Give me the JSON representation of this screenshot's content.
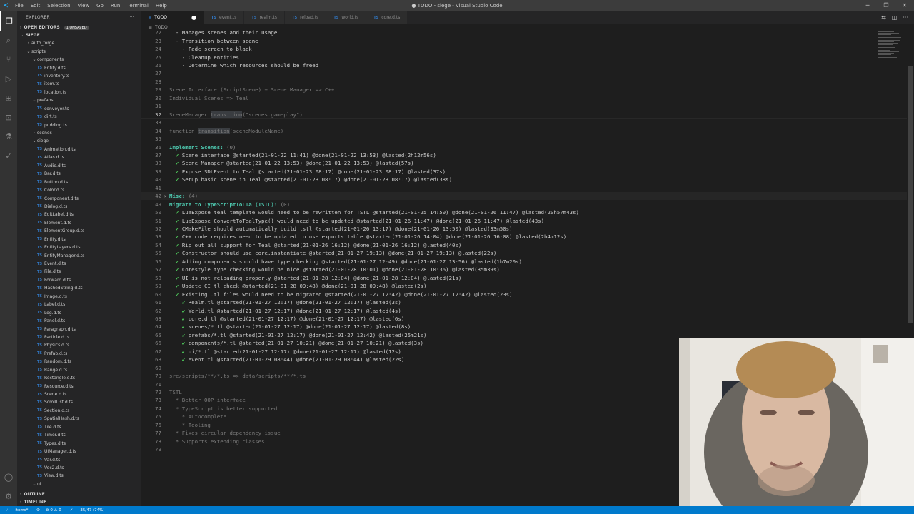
{
  "titlebar": {
    "menu": [
      "File",
      "Edit",
      "Selection",
      "View",
      "Go",
      "Run",
      "Terminal",
      "Help"
    ],
    "title": "● TODO - siege - Visual Studio Code"
  },
  "sidebar": {
    "header": "EXPLORER",
    "open_editors": "OPEN EDITORS",
    "unsaved_badge": "1 UNSAVED",
    "root": "SIEGE",
    "tree": [
      {
        "label": "auto_forge",
        "kind": "folder",
        "depth": 1,
        "open": false
      },
      {
        "label": "scripts",
        "kind": "folder",
        "depth": 1,
        "open": true
      },
      {
        "label": "components",
        "kind": "folder",
        "depth": 2,
        "open": true
      },
      {
        "label": "Entity.d.ts",
        "kind": "file",
        "depth": 3
      },
      {
        "label": "inventory.ts",
        "kind": "file",
        "depth": 3
      },
      {
        "label": "item.ts",
        "kind": "file",
        "depth": 3
      },
      {
        "label": "location.ts",
        "kind": "file",
        "depth": 3
      },
      {
        "label": "prefabs",
        "kind": "folder",
        "depth": 2,
        "open": true
      },
      {
        "label": "conveyor.ts",
        "kind": "file",
        "depth": 3
      },
      {
        "label": "dirt.ts",
        "kind": "file",
        "depth": 3
      },
      {
        "label": "pudding.ts",
        "kind": "file",
        "depth": 3
      },
      {
        "label": "scenes",
        "kind": "folder",
        "depth": 2,
        "open": false
      },
      {
        "label": "siege",
        "kind": "folder",
        "depth": 2,
        "open": true
      },
      {
        "label": "Animation.d.ts",
        "kind": "file",
        "depth": 3
      },
      {
        "label": "Atlas.d.ts",
        "kind": "file",
        "depth": 3
      },
      {
        "label": "Audio.d.ts",
        "kind": "file",
        "depth": 3
      },
      {
        "label": "Bar.d.ts",
        "kind": "file",
        "depth": 3
      },
      {
        "label": "Button.d.ts",
        "kind": "file",
        "depth": 3
      },
      {
        "label": "Color.d.ts",
        "kind": "file",
        "depth": 3
      },
      {
        "label": "Component.d.ts",
        "kind": "file",
        "depth": 3
      },
      {
        "label": "Dialog.d.ts",
        "kind": "file",
        "depth": 3
      },
      {
        "label": "EditLabel.d.ts",
        "kind": "file",
        "depth": 3
      },
      {
        "label": "Element.d.ts",
        "kind": "file",
        "depth": 3
      },
      {
        "label": "ElementGroup.d.ts",
        "kind": "file",
        "depth": 3
      },
      {
        "label": "Entity.d.ts",
        "kind": "file",
        "depth": 3
      },
      {
        "label": "EntityLayers.d.ts",
        "kind": "file",
        "depth": 3
      },
      {
        "label": "EntityManager.d.ts",
        "kind": "file",
        "depth": 3
      },
      {
        "label": "Event.d.ts",
        "kind": "file",
        "depth": 3
      },
      {
        "label": "File.d.ts",
        "kind": "file",
        "depth": 3
      },
      {
        "label": "Forward.d.ts",
        "kind": "file",
        "depth": 3
      },
      {
        "label": "HashedString.d.ts",
        "kind": "file",
        "depth": 3
      },
      {
        "label": "Image.d.ts",
        "kind": "file",
        "depth": 3
      },
      {
        "label": "Label.d.ts",
        "kind": "file",
        "depth": 3
      },
      {
        "label": "Log.d.ts",
        "kind": "file",
        "depth": 3
      },
      {
        "label": "Panel.d.ts",
        "kind": "file",
        "depth": 3
      },
      {
        "label": "Paragraph.d.ts",
        "kind": "file",
        "depth": 3
      },
      {
        "label": "Particle.d.ts",
        "kind": "file",
        "depth": 3
      },
      {
        "label": "Physics.d.ts",
        "kind": "file",
        "depth": 3
      },
      {
        "label": "Prefab.d.ts",
        "kind": "file",
        "depth": 3
      },
      {
        "label": "Random.d.ts",
        "kind": "file",
        "depth": 3
      },
      {
        "label": "Range.d.ts",
        "kind": "file",
        "depth": 3
      },
      {
        "label": "Rectangle.d.ts",
        "kind": "file",
        "depth": 3
      },
      {
        "label": "Resource.d.ts",
        "kind": "file",
        "depth": 3
      },
      {
        "label": "Scene.d.ts",
        "kind": "file",
        "depth": 3
      },
      {
        "label": "ScrollList.d.ts",
        "kind": "file",
        "depth": 3
      },
      {
        "label": "Section.d.ts",
        "kind": "file",
        "depth": 3
      },
      {
        "label": "SpatialHash.d.ts",
        "kind": "file",
        "depth": 3
      },
      {
        "label": "Tile.d.ts",
        "kind": "file",
        "depth": 3
      },
      {
        "label": "Timer.d.ts",
        "kind": "file",
        "depth": 3
      },
      {
        "label": "Types.d.ts",
        "kind": "file",
        "depth": 3
      },
      {
        "label": "UIManager.d.ts",
        "kind": "file",
        "depth": 3
      },
      {
        "label": "Var.d.ts",
        "kind": "file",
        "depth": 3
      },
      {
        "label": "Vec2.d.ts",
        "kind": "file",
        "depth": 3
      },
      {
        "label": "View.d.ts",
        "kind": "file",
        "depth": 3
      },
      {
        "label": "ui",
        "kind": "folder",
        "depth": 2,
        "open": true
      }
    ],
    "outline": "OUTLINE",
    "timeline": "TIMELINE"
  },
  "tabs": [
    {
      "label": "TODO",
      "active": true,
      "dirty": true,
      "icon": "list-icon"
    },
    {
      "label": "event.ts",
      "active": false,
      "icon": "ts-icon"
    },
    {
      "label": "realm.ts",
      "active": false,
      "icon": "ts-icon"
    },
    {
      "label": "reload.ts",
      "active": false,
      "icon": "ts-icon"
    },
    {
      "label": "world.ts",
      "active": false,
      "icon": "ts-icon"
    },
    {
      "label": "core.d.ts",
      "active": false,
      "icon": "ts-icon"
    }
  ],
  "breadcrumb": "TODO",
  "code_lines": [
    {
      "n": "22",
      "segs": [
        [
          "c-plain",
          "  - Manages scenes and their usage"
        ]
      ]
    },
    {
      "n": "23",
      "segs": [
        [
          "c-plain",
          "  - Transition between scene"
        ]
      ]
    },
    {
      "n": "24",
      "segs": [
        [
          "c-plain",
          "    - Fade screen to black"
        ]
      ]
    },
    {
      "n": "25",
      "segs": [
        [
          "c-plain",
          "    - Cleanup entities"
        ]
      ]
    },
    {
      "n": "26",
      "segs": [
        [
          "c-plain",
          "    - Determine which resources should be freed"
        ]
      ]
    },
    {
      "n": "27",
      "segs": []
    },
    {
      "n": "28",
      "segs": []
    },
    {
      "n": "29",
      "segs": [
        [
          "c-comment",
          "Scene Interface (ScriptScene) + Scene Manager => C++"
        ]
      ]
    },
    {
      "n": "30",
      "segs": [
        [
          "c-comment",
          "Individual Scenes => Teal"
        ]
      ]
    },
    {
      "n": "31",
      "segs": []
    },
    {
      "n": "32",
      "cur": true,
      "segs": [
        [
          "c-comment",
          "SceneManager."
        ],
        [
          "c-comment c-hl",
          "transition"
        ],
        [
          "c-comment",
          "(\"scenes.gameplay\")"
        ]
      ]
    },
    {
      "n": "33",
      "segs": []
    },
    {
      "n": "34",
      "segs": [
        [
          "c-comment",
          "function "
        ],
        [
          "c-comment c-hl",
          "transition"
        ],
        [
          "c-comment",
          "(sceneModuleName)"
        ]
      ]
    },
    {
      "n": "35",
      "segs": []
    },
    {
      "n": "36",
      "segs": [
        [
          "c-header",
          "Implement Scenes: "
        ],
        [
          "c-count",
          "(0)"
        ]
      ]
    },
    {
      "n": "37",
      "segs": [
        [
          "c-check",
          "  ✔ "
        ],
        [
          "c-done",
          "Scene interface @started(21-01-22 11:41) @done(21-01-22 13:53) @lasted(2h12m56s)"
        ]
      ]
    },
    {
      "n": "38",
      "segs": [
        [
          "c-check",
          "  ✔ "
        ],
        [
          "c-done",
          "Scene Manager @started(21-01-22 13:53) @done(21-01-22 13:53) @lasted(57s)"
        ]
      ]
    },
    {
      "n": "39",
      "segs": [
        [
          "c-check",
          "  ✔ "
        ],
        [
          "c-done",
          "Expose SDLEvent to Teal @started(21-01-23 08:17) @done(21-01-23 08:17) @lasted(37s)"
        ]
      ]
    },
    {
      "n": "40",
      "segs": [
        [
          "c-check",
          "  ✔ "
        ],
        [
          "c-done",
          "Setup basic scene in Teal @started(21-01-23 08:17) @done(21-01-23 08:17) @lasted(38s)"
        ]
      ]
    },
    {
      "n": "41",
      "segs": []
    },
    {
      "n": "42",
      "fold": true,
      "segs": [
        [
          "c-header",
          "Misc: "
        ],
        [
          "c-count",
          "(4)"
        ]
      ]
    },
    {
      "n": "49",
      "segs": [
        [
          "c-header",
          "Migrate to TypeScriptToLua (TSTL): "
        ],
        [
          "c-count",
          "(0)"
        ]
      ]
    },
    {
      "n": "50",
      "segs": [
        [
          "c-check",
          "  ✔ "
        ],
        [
          "c-done",
          "LuaExpose teal template would need to be rewritten for TSTL @started(21-01-25 14:50) @done(21-01-26 11:47) @lasted(20h57m43s)"
        ]
      ]
    },
    {
      "n": "51",
      "segs": [
        [
          "c-check",
          "  ✔ "
        ],
        [
          "c-done",
          "LuaExpose ConvertToTealType() would need to be updated @started(21-01-26 11:47) @done(21-01-26 11:47) @lasted(43s)"
        ]
      ]
    },
    {
      "n": "52",
      "segs": [
        [
          "c-check",
          "  ✔ "
        ],
        [
          "c-done",
          "CMakeFile should automatically build tstl @started(21-01-26 13:17) @done(21-01-26 13:50) @lasted(33m50s)"
        ]
      ]
    },
    {
      "n": "53",
      "segs": [
        [
          "c-check",
          "  ✔ "
        ],
        [
          "c-done",
          "C++ code requires need to be updated to use exports table @started(21-01-26 14:04) @done(21-01-26 16:08) @lasted(2h4m12s)"
        ]
      ]
    },
    {
      "n": "54",
      "segs": [
        [
          "c-check",
          "  ✔ "
        ],
        [
          "c-done",
          "Rip out all support for Teal @started(21-01-26 16:12) @done(21-01-26 16:12) @lasted(40s)"
        ]
      ]
    },
    {
      "n": "55",
      "segs": [
        [
          "c-check",
          "  ✔ "
        ],
        [
          "c-done",
          "Constructor should use core.instantiate @started(21-01-27 19:13) @done(21-01-27 19:13) @lasted(22s)"
        ]
      ]
    },
    {
      "n": "56",
      "segs": [
        [
          "c-check",
          "  ✔ "
        ],
        [
          "c-done",
          "Adding components should have type checking @started(21-01-27 12:49) @done(21-01-27 13:56) @lasted(1h7m20s)"
        ]
      ]
    },
    {
      "n": "57",
      "segs": [
        [
          "c-check",
          "  ✔ "
        ],
        [
          "c-done",
          "Corestyle type checking would be nice @started(21-01-28 10:01) @done(21-01-28 10:36) @lasted(35m39s)"
        ]
      ]
    },
    {
      "n": "58",
      "segs": [
        [
          "c-check",
          "  ✔ "
        ],
        [
          "c-done",
          "UI is not reloading properly @started(21-01-28 12:04) @done(21-01-28 12:04) @lasted(21s)"
        ]
      ]
    },
    {
      "n": "59",
      "segs": [
        [
          "c-check",
          "  ✔ "
        ],
        [
          "c-done",
          "Update CI tl check @started(21-01-28 09:48) @done(21-01-28 09:48) @lasted(2s)"
        ]
      ]
    },
    {
      "n": "60",
      "segs": [
        [
          "c-check",
          "  ✔ "
        ],
        [
          "c-done",
          "Existing .tl files would need to be migrated @started(21-01-27 12:42) @done(21-01-27 12:42) @lasted(23s)"
        ]
      ]
    },
    {
      "n": "61",
      "segs": [
        [
          "c-check",
          "    ✔ "
        ],
        [
          "c-done",
          "Realm.tl @started(21-01-27 12:17) @done(21-01-27 12:17) @lasted(3s)"
        ]
      ]
    },
    {
      "n": "62",
      "segs": [
        [
          "c-check",
          "    ✔ "
        ],
        [
          "c-done",
          "World.tl @started(21-01-27 12:17) @done(21-01-27 12:17) @lasted(4s)"
        ]
      ]
    },
    {
      "n": "63",
      "segs": [
        [
          "c-check",
          "    ✔ "
        ],
        [
          "c-done",
          "core.d.tl @started(21-01-27 12:17) @done(21-01-27 12:17) @lasted(6s)"
        ]
      ]
    },
    {
      "n": "64",
      "segs": [
        [
          "c-check",
          "    ✔ "
        ],
        [
          "c-done",
          "scenes/*.tl @started(21-01-27 12:17) @done(21-01-27 12:17) @lasted(8s)"
        ]
      ]
    },
    {
      "n": "65",
      "segs": [
        [
          "c-check",
          "    ✔ "
        ],
        [
          "c-done",
          "prefabs/*.tl @started(21-01-27 12:17) @done(21-01-27 12:42) @lasted(25m21s)"
        ]
      ]
    },
    {
      "n": "66",
      "segs": [
        [
          "c-check",
          "    ✔ "
        ],
        [
          "c-done",
          "components/*.tl @started(21-01-27 10:21) @done(21-01-27 10:21) @lasted(3s)"
        ]
      ]
    },
    {
      "n": "67",
      "segs": [
        [
          "c-check",
          "    ✔ "
        ],
        [
          "c-done",
          "ui/*.tl @started(21-01-27 12:17) @done(21-01-27 12:17) @lasted(12s)"
        ]
      ]
    },
    {
      "n": "68",
      "segs": [
        [
          "c-check",
          "    ✔ "
        ],
        [
          "c-done",
          "event.tl @started(21-01-29 08:44) @done(21-01-29 08:44) @lasted(22s)"
        ]
      ]
    },
    {
      "n": "69",
      "segs": []
    },
    {
      "n": "70",
      "segs": [
        [
          "c-comment",
          "src/scripts/**/*.ts => data/scripts/**/*.ts"
        ]
      ]
    },
    {
      "n": "71",
      "segs": []
    },
    {
      "n": "72",
      "segs": [
        [
          "c-comment",
          "TSTL"
        ]
      ]
    },
    {
      "n": "73",
      "segs": [
        [
          "c-comment",
          "  * Better OOP interface"
        ]
      ]
    },
    {
      "n": "74",
      "segs": [
        [
          "c-comment",
          "  * TypeScript is better supported"
        ]
      ]
    },
    {
      "n": "75",
      "segs": [
        [
          "c-comment",
          "    * Autocomplete"
        ]
      ]
    },
    {
      "n": "76",
      "segs": [
        [
          "c-comment",
          "    * Tooling"
        ]
      ]
    },
    {
      "n": "77",
      "segs": [
        [
          "c-comment",
          "  * Fixes circular dependency issue"
        ]
      ]
    },
    {
      "n": "78",
      "segs": [
        [
          "c-comment",
          "  * Supports extending classes"
        ]
      ]
    },
    {
      "n": "79",
      "segs": []
    }
  ],
  "statusbar": {
    "branch": "items*",
    "sync": "⟳",
    "problems": "⊗ 0 ⚠ 0",
    "live": "35/47 (74%)"
  },
  "colors": {
    "accent": "#007acc",
    "header": "#4ec9b0",
    "check": "#4ec95b"
  }
}
